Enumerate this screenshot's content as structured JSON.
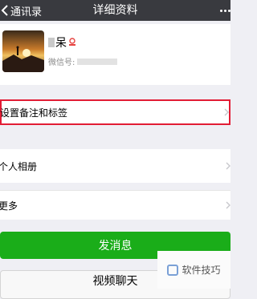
{
  "navbar": {
    "back_label": "通讯录",
    "title": "详细资料",
    "more_icon": "more-dots-icon"
  },
  "profile": {
    "name": "呆",
    "wechat_id_label": "微信号:",
    "gender_icon": "female-icon"
  },
  "rows": {
    "remark": "设置备注和标签",
    "album": "个人相册",
    "more": "更多"
  },
  "actions": {
    "send_message": "发消息",
    "video_chat": "视频聊天"
  },
  "watermark": {
    "text": "软件技巧"
  },
  "colors": {
    "navbar_bg": "#393a3f",
    "primary_green": "#1aad19",
    "highlight_red": "#e21c34",
    "gender_red": "#e64340"
  }
}
